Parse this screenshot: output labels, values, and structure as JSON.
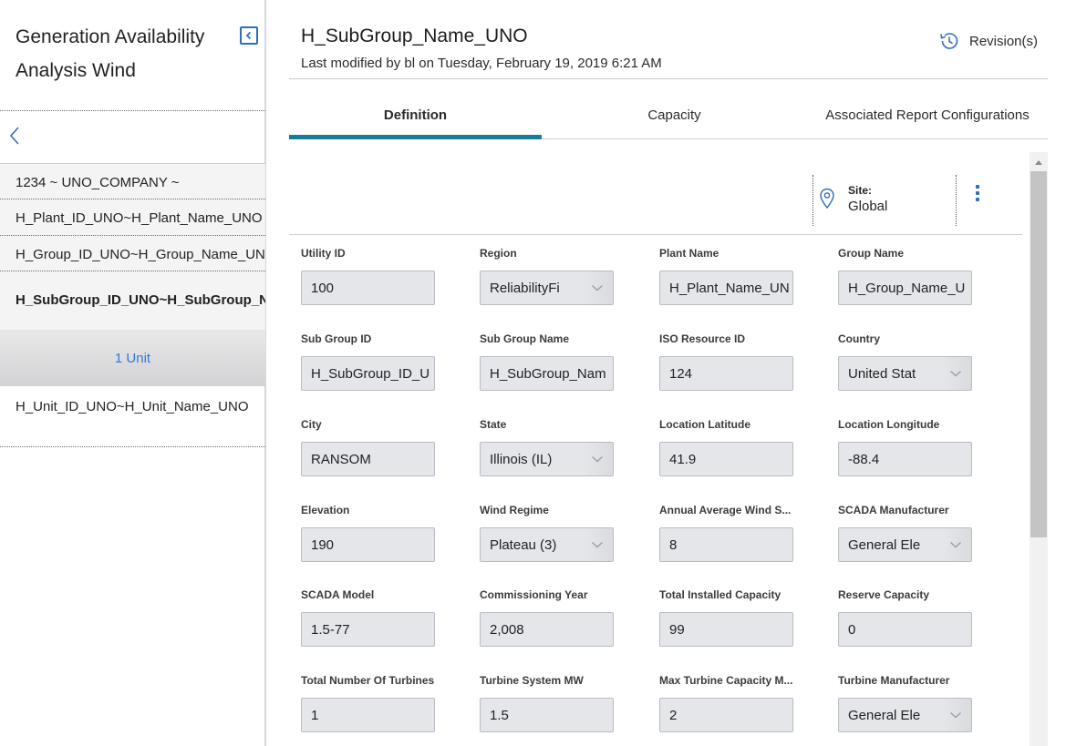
{
  "sidebar": {
    "title": "Generation Availability Analysis Wind",
    "items": [
      "1234 ~ UNO_COMPANY ~",
      "H_Plant_ID_UNO~H_Plant_Name_UNO",
      "H_Group_ID_UNO~H_Group_Name_UNO",
      "H_SubGroup_ID_UNO~H_SubGroup_Name_UNO"
    ],
    "unit_header": "1 Unit",
    "unit_item": "H_Unit_ID_UNO~H_Unit_Name_UNO"
  },
  "header": {
    "title": "H_SubGroup_Name_UNO",
    "subtitle": "Last modified by bl on Tuesday, February 19, 2019 6:21 AM",
    "revisions_label": "Revision(s)"
  },
  "tabs": [
    {
      "label": "Definition",
      "active": true
    },
    {
      "label": "Capacity",
      "active": false
    },
    {
      "label": "Associated Report Configurations",
      "active": false
    }
  ],
  "site": {
    "label": "Site:",
    "value": "Global"
  },
  "accent_color": "#1b7a96",
  "link_color": "#2f6fb7",
  "fields": [
    {
      "label": "Utility ID",
      "value": "100",
      "type": "text"
    },
    {
      "label": "Region",
      "value": "ReliabilityFi",
      "type": "select"
    },
    {
      "label": "Plant Name",
      "value": "H_Plant_Name_UN",
      "type": "text"
    },
    {
      "label": "Group Name",
      "value": "H_Group_Name_U",
      "type": "text"
    },
    {
      "label": "Sub Group ID",
      "value": "H_SubGroup_ID_U",
      "type": "text"
    },
    {
      "label": "Sub Group Name",
      "value": "H_SubGroup_Nam",
      "type": "text"
    },
    {
      "label": "ISO Resource ID",
      "value": "124",
      "type": "text"
    },
    {
      "label": "Country",
      "value": "United Stat",
      "type": "select"
    },
    {
      "label": "City",
      "value": "RANSOM",
      "type": "text"
    },
    {
      "label": "State",
      "value": "Illinois (IL)",
      "type": "select"
    },
    {
      "label": "Location Latitude",
      "value": "41.9",
      "type": "text"
    },
    {
      "label": "Location Longitude",
      "value": "-88.4",
      "type": "text"
    },
    {
      "label": "Elevation",
      "value": "190",
      "type": "text"
    },
    {
      "label": "Wind Regime",
      "value": "Plateau (3)",
      "type": "select"
    },
    {
      "label": "Annual Average Wind S...",
      "value": "8",
      "type": "text"
    },
    {
      "label": "SCADA Manufacturer",
      "value": "General Ele",
      "type": "select"
    },
    {
      "label": "SCADA Model",
      "value": "1.5-77",
      "type": "text"
    },
    {
      "label": "Commissioning Year",
      "value": "2,008",
      "type": "text"
    },
    {
      "label": "Total Installed Capacity",
      "value": "99",
      "type": "text"
    },
    {
      "label": "Reserve Capacity",
      "value": "0",
      "type": "text"
    },
    {
      "label": "Total Number Of Turbines",
      "value": "1",
      "type": "text"
    },
    {
      "label": "Turbine System MW",
      "value": "1.5",
      "type": "text"
    },
    {
      "label": "Max Turbine Capacity M...",
      "value": "2",
      "type": "text"
    },
    {
      "label": "Turbine Manufacturer",
      "value": "General Ele",
      "type": "select"
    }
  ]
}
